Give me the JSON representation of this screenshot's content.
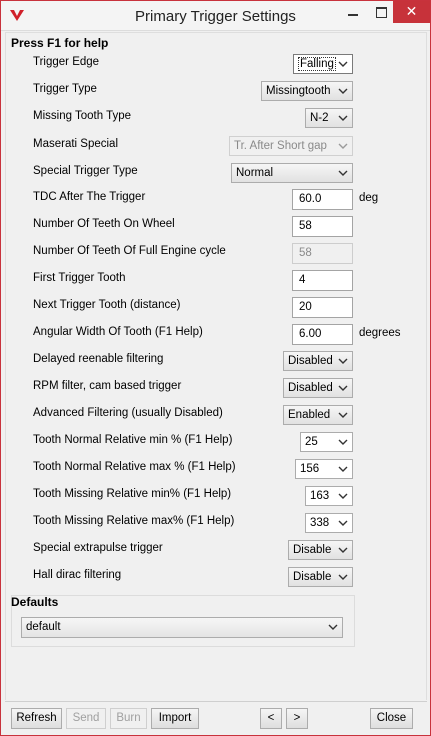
{
  "window": {
    "title": "Primary Trigger Settings",
    "close_glyph": "✕"
  },
  "help_text": "Press F1 for help",
  "fields": [
    {
      "label": "Trigger Edge",
      "kind": "select",
      "value": "Falling",
      "focused": true
    },
    {
      "label": "Trigger Type",
      "kind": "select",
      "value": "Missingtooth"
    },
    {
      "label": "Missing Tooth Type",
      "kind": "select",
      "value": "N-2"
    },
    {
      "label": "Maserati Special",
      "kind": "select",
      "value": "Tr. After Short gap",
      "disabled": true
    },
    {
      "label": "Special Trigger Type",
      "kind": "select",
      "value": "Normal"
    },
    {
      "label": "TDC After The Trigger",
      "kind": "input",
      "value": "60.0",
      "unit": "deg"
    },
    {
      "label": "Number Of Teeth On Wheel",
      "kind": "input",
      "value": "58"
    },
    {
      "label": "Number Of Teeth Of Full Engine cycle",
      "kind": "input",
      "value": "58",
      "disabled": true
    },
    {
      "label": "First Trigger Tooth",
      "kind": "input",
      "value": "4"
    },
    {
      "label": "Next Trigger Tooth (distance)",
      "kind": "input",
      "value": "20"
    },
    {
      "label": "Angular Width Of Tooth (F1 Help)",
      "kind": "input",
      "value": "6.00",
      "unit": "degrees"
    },
    {
      "label": "Delayed reenable filtering",
      "kind": "select",
      "value": "Disabled"
    },
    {
      "label": "RPM filter, cam based trigger",
      "kind": "select",
      "value": "Disabled"
    },
    {
      "label": "Advanced Filtering (usually Disabled)",
      "kind": "select",
      "value": "Enabled"
    },
    {
      "label": "Tooth Normal Relative min % (F1 Help)",
      "kind": "select",
      "value": "25"
    },
    {
      "label": "Tooth Normal Relative max % (F1 Help)",
      "kind": "select",
      "value": "156"
    },
    {
      "label": "Tooth Missing Relative min% (F1 Help)",
      "kind": "select",
      "value": "163"
    },
    {
      "label": "Tooth Missing Relative max% (F1 Help)",
      "kind": "select",
      "value": "338"
    },
    {
      "label": "Special extrapulse trigger",
      "kind": "select",
      "value": "Disable"
    },
    {
      "label": "Hall dirac filtering",
      "kind": "select",
      "value": "Disable"
    }
  ],
  "defaults": {
    "title": "Defaults",
    "value": "default"
  },
  "buttons": {
    "refresh": "Refresh",
    "send": "Send",
    "burn": "Burn",
    "import": "Import",
    "prev": "<",
    "next": ">",
    "close": "Close"
  },
  "colors": {
    "close_button": "#c7323a",
    "icon_red": "#d0202a"
  }
}
